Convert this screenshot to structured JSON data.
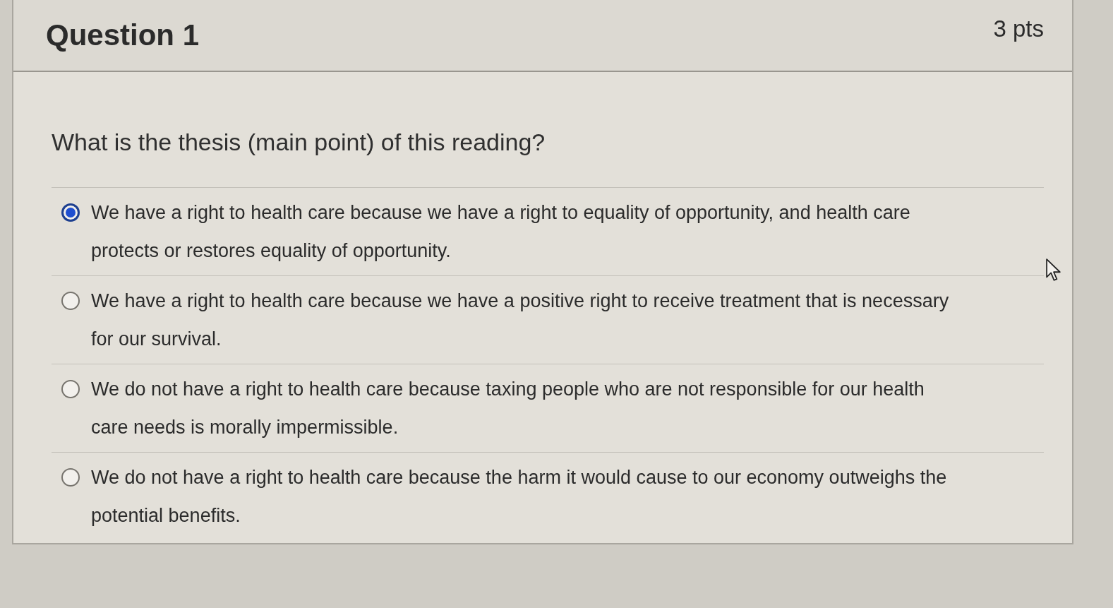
{
  "question": {
    "title": "Question 1",
    "points": "3 pts",
    "prompt": "What is the thesis (main point) of this reading?",
    "answers": [
      {
        "text": "We have a right to health care because we have a right to equality of opportunity, and health care protects or restores equality of opportunity.",
        "selected": true
      },
      {
        "text": "We have a right to health care because we have a positive right to receive treatment that is necessary for our survival.",
        "selected": false
      },
      {
        "text": "We do not have a right to health care because taxing people who are not responsible for our health care needs is morally impermissible.",
        "selected": false
      },
      {
        "text": "We do not have a right to health care because the harm it would cause to our economy outweighs the potential benefits.",
        "selected": false
      }
    ]
  }
}
